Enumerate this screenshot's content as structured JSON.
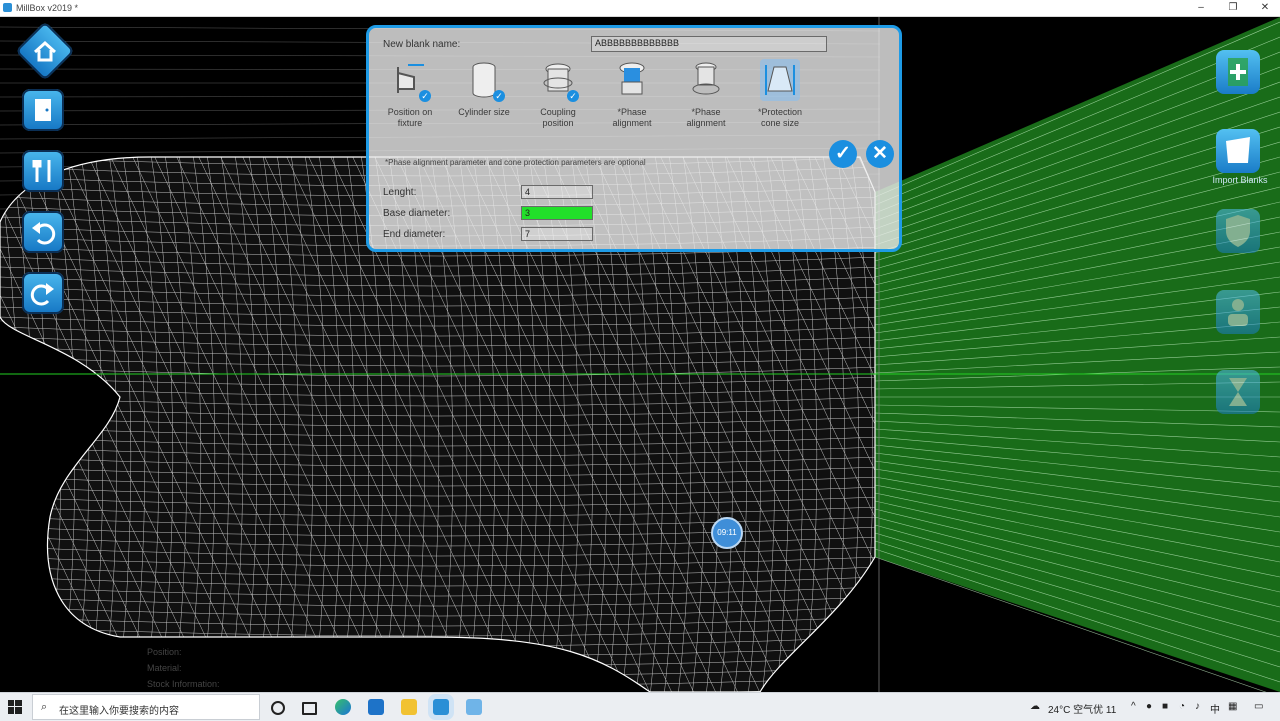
{
  "window": {
    "title": "MillBox v2019 *",
    "minimize": "–",
    "restore": "❐",
    "close": "✕"
  },
  "sidebar_left": {
    "buttons": [
      {
        "name": "home-button",
        "icon": "home-icon"
      },
      {
        "name": "door-button",
        "icon": "door-icon"
      },
      {
        "name": "tools-button",
        "icon": "tools-icon"
      },
      {
        "name": "undo-button",
        "icon": "undo-icon"
      },
      {
        "name": "redo-button",
        "icon": "redo-icon"
      }
    ]
  },
  "sidebar_right": {
    "buttons": [
      {
        "label": "",
        "icon": "add-document-icon"
      },
      {
        "label": "Import Blanks",
        "icon": "import-icon"
      },
      {
        "label": "",
        "icon": "shield-icon"
      },
      {
        "label": "",
        "icon": "user-icon"
      },
      {
        "label": "",
        "icon": "hourglass-icon"
      }
    ]
  },
  "dialog": {
    "blank_name_label": "New blank name:",
    "blank_name_value": "ABBBBBBBBBBBBB",
    "steps": [
      {
        "line1": "Position on",
        "line2": "fixture",
        "done": true,
        "icon": "fixture-icon"
      },
      {
        "line1": "Cylinder size",
        "line2": "",
        "done": true,
        "icon": "cylinder-icon"
      },
      {
        "line1": "Coupling",
        "line2": "position",
        "done": true,
        "icon": "coupling-icon"
      },
      {
        "line1": "*Phase",
        "line2": "alignment",
        "done": false,
        "icon": "phase-alignment-icon"
      },
      {
        "line1": "*Phase",
        "line2": "alignment",
        "done": false,
        "icon": "phase-alignment-2-icon"
      },
      {
        "line1": "*Protection",
        "line2": "cone size",
        "done": false,
        "icon": "protection-cone-icon"
      }
    ],
    "note": "*Phase alignment parameter and cone protection parameters are optional",
    "fields": [
      {
        "label": "Lenght:",
        "value": "4"
      },
      {
        "label": "Base diameter:",
        "value": "3"
      },
      {
        "label": "End diameter:",
        "value": "7"
      }
    ],
    "ok_symbol": "✓",
    "cancel_symbol": "✕"
  },
  "timer": "09:11",
  "info": {
    "position": "Position:",
    "material": "Material:",
    "stock": "Stock Information:"
  },
  "taskbar": {
    "search_placeholder": "在这里输入你要搜索的内容",
    "weather": "24°C  空气优 11",
    "ime": "中",
    "icons": [
      "windows-start-icon",
      "cortana-icon",
      "task-view-icon",
      "edge-icon",
      "mail-icon",
      "explorer-icon",
      "millbox-icon",
      "notepad-icon"
    ]
  },
  "colors": {
    "accent": "#1e9be6",
    "mesh": "#ffffff",
    "fixture": "#2ec42e",
    "active_field": "#22e02a"
  }
}
